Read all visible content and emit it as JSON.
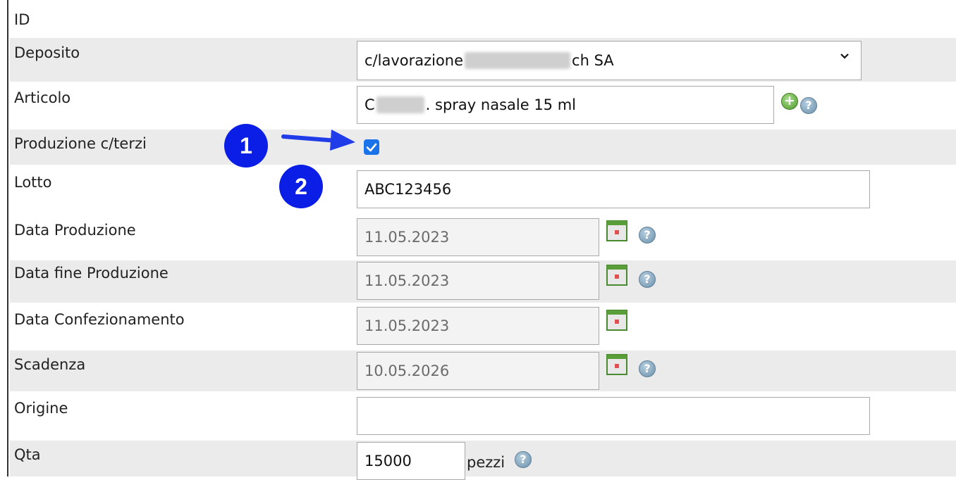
{
  "form": {
    "id_label": "ID",
    "deposito": {
      "label": "Deposito",
      "value_start": "c/lavorazione",
      "value_end": "ch SA",
      "chevron_icon": "chevron-down-icon"
    },
    "articolo": {
      "label": "Articolo",
      "value_start": "C",
      "value_end": ". spray nasale 15 ml",
      "add_icon": "plus-icon",
      "help_icon": "help-icon"
    },
    "produzione_cterzi": {
      "label": "Produzione c/terzi",
      "checked": true
    },
    "lotto": {
      "label": "Lotto",
      "value": "ABC123456"
    },
    "data_produzione": {
      "label": "Data Produzione",
      "value": "11.05.2023"
    },
    "data_fine_produzione": {
      "label": "Data fine Produzione",
      "value": "11.05.2023"
    },
    "data_confezionamento": {
      "label": "Data Confezionamento",
      "value": "11.05.2023"
    },
    "scadenza": {
      "label": "Scadenza",
      "value": "10.05.2026"
    },
    "origine": {
      "label": "Origine",
      "value": ""
    },
    "qta": {
      "label": "Qta",
      "value": "15000",
      "unit": "pezzi"
    }
  },
  "annotations": {
    "badge1": "1",
    "badge2": "2",
    "arrow_color": "#1f3ce8",
    "badge_color": "#0a1ee6"
  },
  "colors": {
    "row_shade": "#ebebeb",
    "checkbox": "#1a73e8",
    "help_icon": "#7fa3bd",
    "add_icon": "#5fae3c",
    "calendar_icon": "#5a9e3a"
  }
}
